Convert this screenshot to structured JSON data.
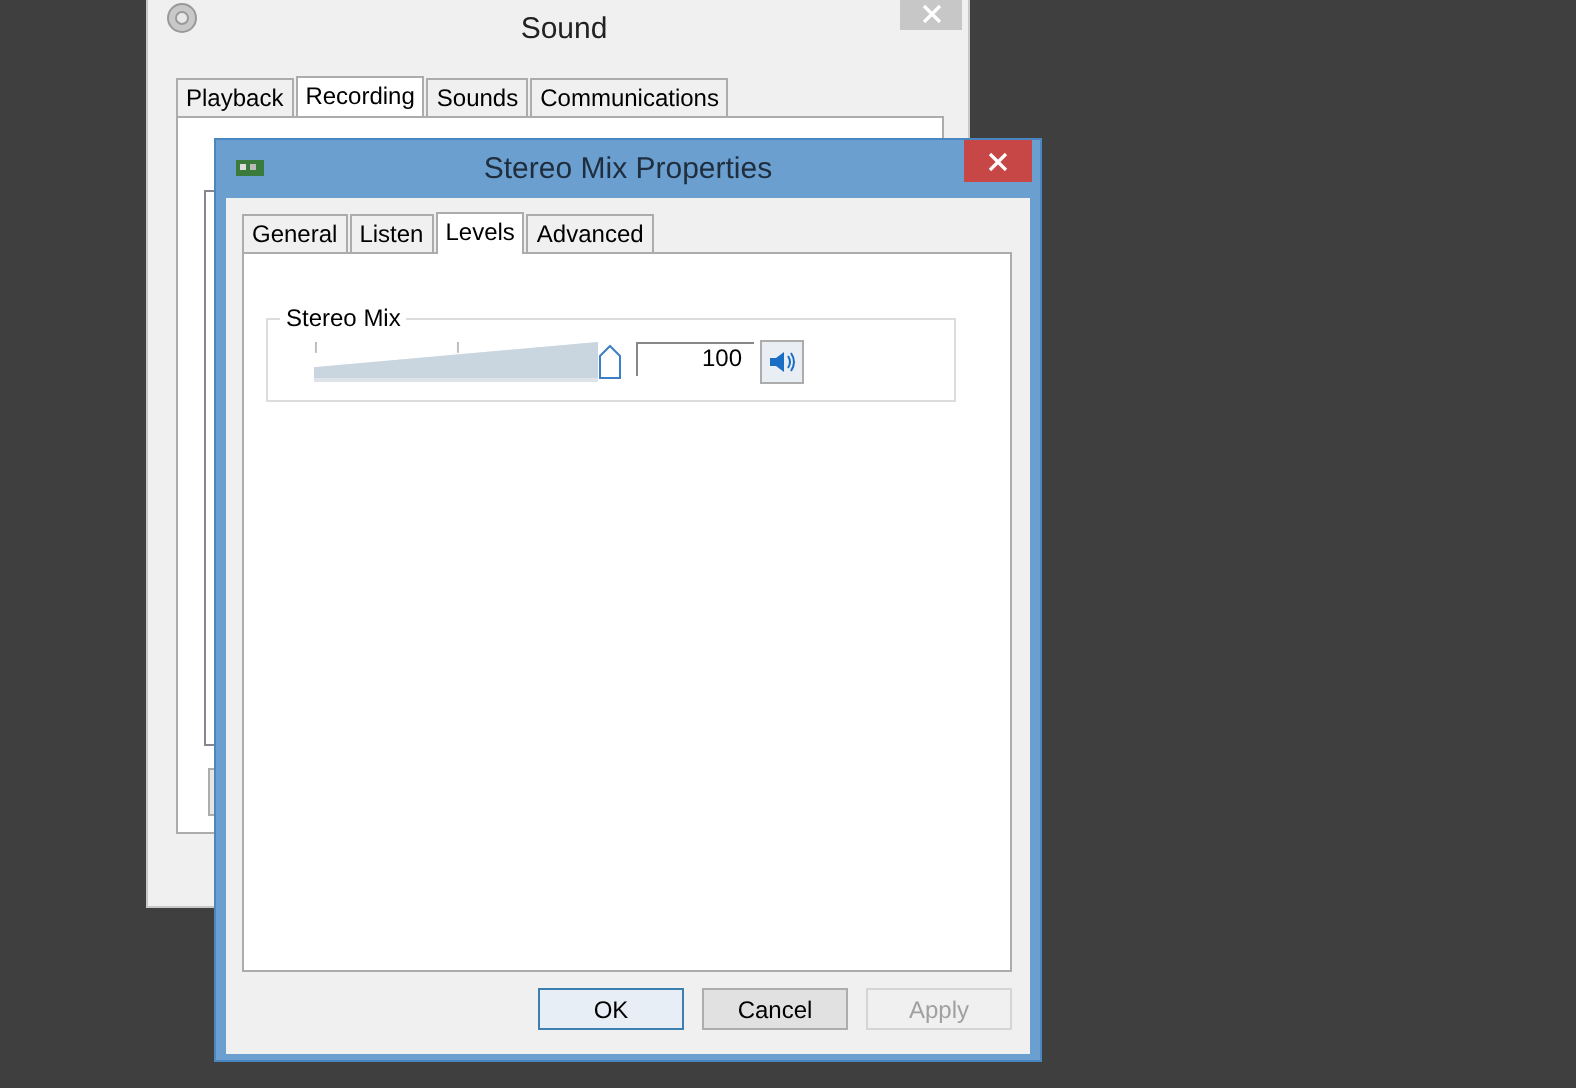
{
  "sound_window": {
    "title": "Sound",
    "tabs": [
      {
        "label": "Playback",
        "selected": false
      },
      {
        "label": "Recording",
        "selected": true
      },
      {
        "label": "Sounds",
        "selected": false
      },
      {
        "label": "Communications",
        "selected": false
      }
    ]
  },
  "dialog": {
    "title": "Stereo Mix Properties",
    "tabs": [
      {
        "label": "General",
        "selected": false
      },
      {
        "label": "Listen",
        "selected": false
      },
      {
        "label": "Levels",
        "selected": true
      },
      {
        "label": "Advanced",
        "selected": false
      }
    ],
    "levels": [
      {
        "name": "Stereo Mix",
        "level": 1.0,
        "value": "100",
        "muted": false
      }
    ],
    "buttons": [
      {
        "label": "OK",
        "default": true,
        "disabled": false
      },
      {
        "label": "Cancel",
        "default": false,
        "disabled": false
      },
      {
        "label": "Apply",
        "default": false,
        "disabled": true
      }
    ]
  }
}
